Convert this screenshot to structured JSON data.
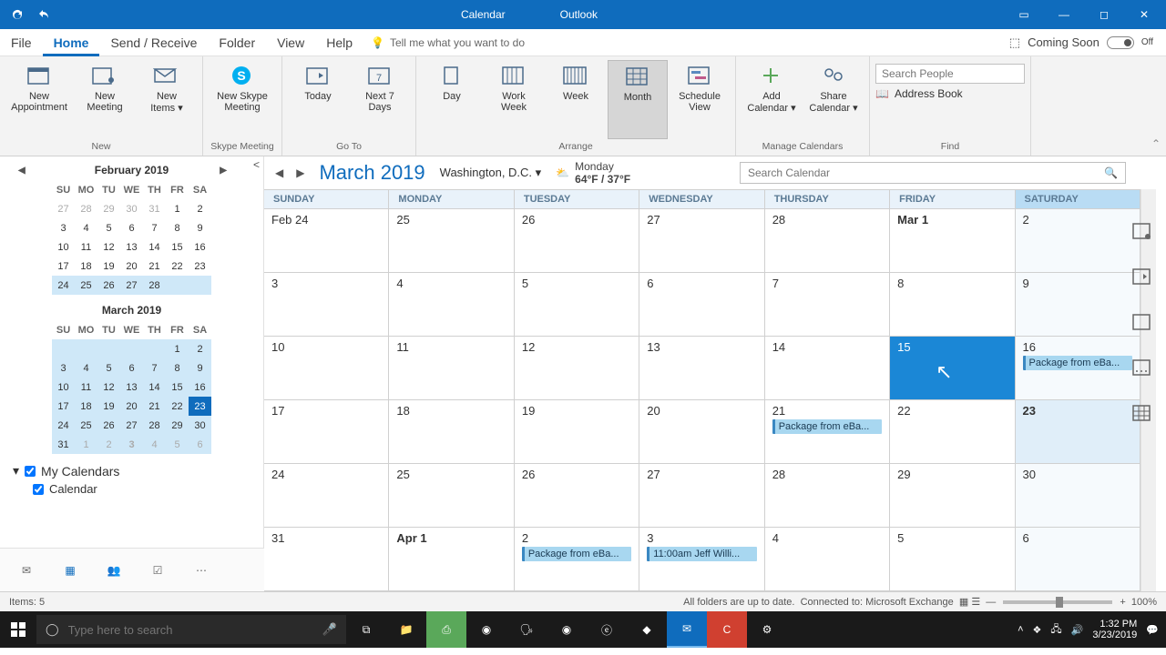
{
  "titlebar": {
    "app": "Calendar",
    "product": "Outlook"
  },
  "tabs": {
    "file": "File",
    "home": "Home",
    "sendreceive": "Send / Receive",
    "folder": "Folder",
    "view": "View",
    "help": "Help",
    "tellme": "Tell me what you want to do"
  },
  "coming": {
    "label": "Coming Soon",
    "toggle": "Off"
  },
  "ribbon": {
    "newAppt": "New\nAppointment",
    "newMeeting": "New\nMeeting",
    "newItems": "New\nItems ▾",
    "skype": "New Skype\nMeeting",
    "today": "Today",
    "next7": "Next 7\nDays",
    "day": "Day",
    "workweek": "Work\nWeek",
    "week": "Week",
    "month": "Month",
    "schedule": "Schedule\nView",
    "addCal": "Add\nCalendar ▾",
    "shareCal": "Share\nCalendar ▾",
    "searchPeople": "Search People",
    "addressBook": "Address Book",
    "groups": {
      "new": "New",
      "skype": "Skype Meeting",
      "goto": "Go To",
      "arrange": "Arrange",
      "manage": "Manage Calendars",
      "find": "Find"
    }
  },
  "miniCalFeb": {
    "title": "February 2019",
    "dow": [
      "SU",
      "MO",
      "TU",
      "WE",
      "TH",
      "FR",
      "SA"
    ],
    "rows": [
      [
        "27",
        "28",
        "29",
        "30",
        "31",
        "1",
        "2"
      ],
      [
        "3",
        "4",
        "5",
        "6",
        "7",
        "8",
        "9"
      ],
      [
        "10",
        "11",
        "12",
        "13",
        "14",
        "15",
        "16"
      ],
      [
        "17",
        "18",
        "19",
        "20",
        "21",
        "22",
        "23"
      ],
      [
        "24",
        "25",
        "26",
        "27",
        "28",
        "",
        ""
      ]
    ]
  },
  "miniCalMar": {
    "title": "March 2019",
    "dow": [
      "SU",
      "MO",
      "TU",
      "WE",
      "TH",
      "FR",
      "SA"
    ],
    "rows": [
      [
        "",
        "",
        "",
        "",
        "",
        "1",
        "2"
      ],
      [
        "3",
        "4",
        "5",
        "6",
        "7",
        "8",
        "9"
      ],
      [
        "10",
        "11",
        "12",
        "13",
        "14",
        "15",
        "16"
      ],
      [
        "17",
        "18",
        "19",
        "20",
        "21",
        "22",
        "23"
      ],
      [
        "24",
        "25",
        "26",
        "27",
        "28",
        "29",
        "30"
      ],
      [
        "31",
        "1",
        "2",
        "3",
        "4",
        "5",
        "6"
      ]
    ]
  },
  "myCal": {
    "header": "My Calendars",
    "item1": "Calendar"
  },
  "calHeader": {
    "month": "March 2019",
    "location": "Washington,  D.C. ▾",
    "weatherDay": "Monday",
    "weatherTemp": "64°F / 37°F",
    "searchPlaceholder": "Search Calendar"
  },
  "dayHeaders": [
    "SUNDAY",
    "MONDAY",
    "TUESDAY",
    "WEDNESDAY",
    "THURSDAY",
    "FRIDAY",
    "SATURDAY"
  ],
  "grid": [
    [
      {
        "n": "Feb 24"
      },
      {
        "n": "25"
      },
      {
        "n": "26"
      },
      {
        "n": "27"
      },
      {
        "n": "28"
      },
      {
        "n": "Mar 1",
        "bold": true
      },
      {
        "n": "2"
      }
    ],
    [
      {
        "n": "3"
      },
      {
        "n": "4"
      },
      {
        "n": "5"
      },
      {
        "n": "6"
      },
      {
        "n": "7"
      },
      {
        "n": "8"
      },
      {
        "n": "9"
      }
    ],
    [
      {
        "n": "10"
      },
      {
        "n": "11"
      },
      {
        "n": "12"
      },
      {
        "n": "13"
      },
      {
        "n": "14"
      },
      {
        "n": "15",
        "selected": true
      },
      {
        "n": "16",
        "ev": "Package from eBa..."
      }
    ],
    [
      {
        "n": "17"
      },
      {
        "n": "18"
      },
      {
        "n": "19"
      },
      {
        "n": "20"
      },
      {
        "n": "21",
        "ev": "Package from eBa..."
      },
      {
        "n": "22"
      },
      {
        "n": "23",
        "bold": true,
        "today": true
      }
    ],
    [
      {
        "n": "24"
      },
      {
        "n": "25"
      },
      {
        "n": "26"
      },
      {
        "n": "27"
      },
      {
        "n": "28"
      },
      {
        "n": "29"
      },
      {
        "n": "30"
      }
    ],
    [
      {
        "n": "31"
      },
      {
        "n": "Apr 1",
        "bold": true
      },
      {
        "n": "2",
        "ev": "Package from eBa..."
      },
      {
        "n": "3",
        "ev": "11:00am Jeff Willi..."
      },
      {
        "n": "4"
      },
      {
        "n": "5"
      },
      {
        "n": "6"
      }
    ]
  ],
  "status": {
    "items": "Items: 5",
    "folders": "All folders are up to date.",
    "connected": "Connected to: Microsoft Exchange",
    "zoom": "100%"
  },
  "taskbar": {
    "searchPlaceholder": "Type here to search",
    "time": "1:32 PM",
    "date": "3/23/2019"
  }
}
